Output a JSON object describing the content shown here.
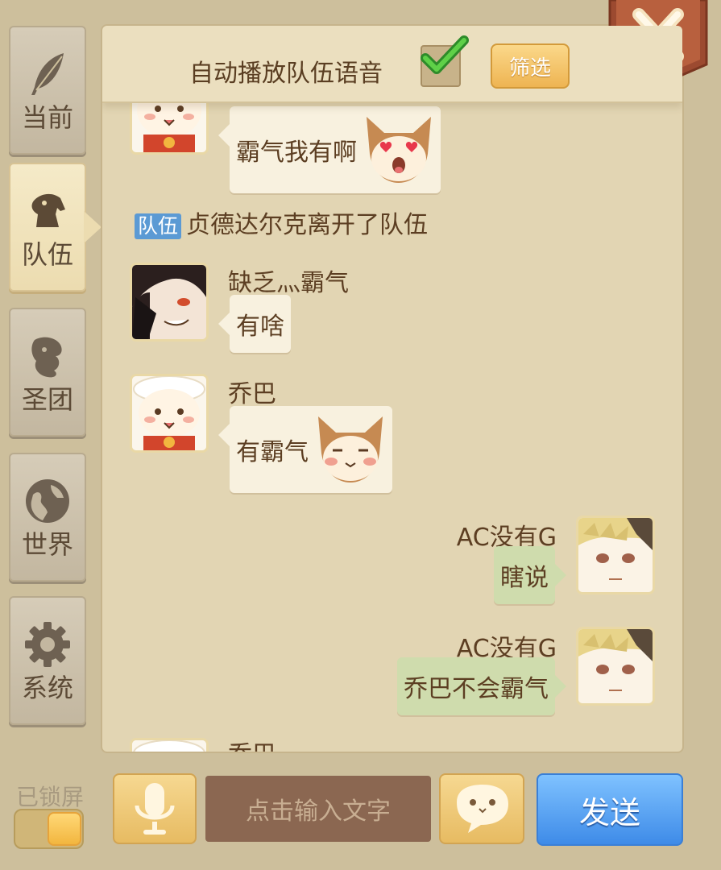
{
  "tabs": [
    {
      "label": "当前",
      "icon": "feather-icon",
      "active": false
    },
    {
      "label": "队伍",
      "icon": "horse-head-icon",
      "active": true
    },
    {
      "label": "圣团",
      "icon": "lion-emblem-icon",
      "active": false
    },
    {
      "label": "世界",
      "icon": "globe-icon",
      "active": false
    },
    {
      "label": "系统",
      "icon": "gear-icon",
      "active": false
    }
  ],
  "header": {
    "auto_play_label": "自动播放队伍语音",
    "auto_play_checked": true,
    "filter_label": "筛选",
    "close_label": "X"
  },
  "messages": {
    "m0": {
      "text": "霸气我有啊",
      "emote": "heart-eyes-fox-emote"
    },
    "system": {
      "tag": "队伍",
      "text": "贞德达尔克离开了队伍"
    },
    "m1": {
      "name": "缺乏灬霸气",
      "text": "有啥"
    },
    "m2": {
      "name": "乔巴",
      "text": "有霸气",
      "emote": "blushing-fox-emote"
    },
    "m3": {
      "name": "AC没有G",
      "text": "瞎说"
    },
    "m4": {
      "name": "AC没有G",
      "text": "乔巴不会霸气"
    },
    "m5": {
      "name": "乔巴"
    }
  },
  "bottom": {
    "lock_label": "已锁屏",
    "lock_on": true,
    "input_placeholder": "点击输入文字",
    "send_label": "发送"
  },
  "colors": {
    "send_blue": "#4a94ee",
    "filter_gold": "#eeb452",
    "my_bubble_green": "#cfdcad",
    "team_tag_blue": "#5b9ad4"
  }
}
